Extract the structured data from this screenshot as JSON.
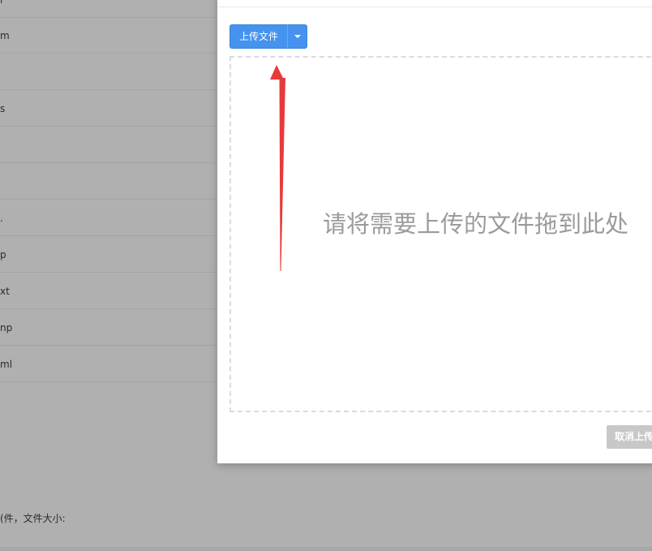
{
  "background_list": {
    "rows": [
      {
        "text": "l"
      },
      {
        "text": "m"
      },
      {
        "text": ""
      },
      {
        "text": "s"
      },
      {
        "text": ""
      },
      {
        "text": ""
      },
      {
        "text": "."
      },
      {
        "text": "p"
      },
      {
        "text": "xt"
      },
      {
        "text": "np"
      },
      {
        "text": "ml"
      }
    ],
    "footer_text": "(件，文件大小:"
  },
  "modal": {
    "upload_button_label": "上传文件",
    "dropzone_hint": "请将需要上传的文件拖到此处",
    "cancel_button_label": "取消上传"
  },
  "colors": {
    "overlay": "#b0b0b0",
    "primary": "#4593ee",
    "arrow": "#e83a3a",
    "disabled": "#c8c8c8"
  }
}
